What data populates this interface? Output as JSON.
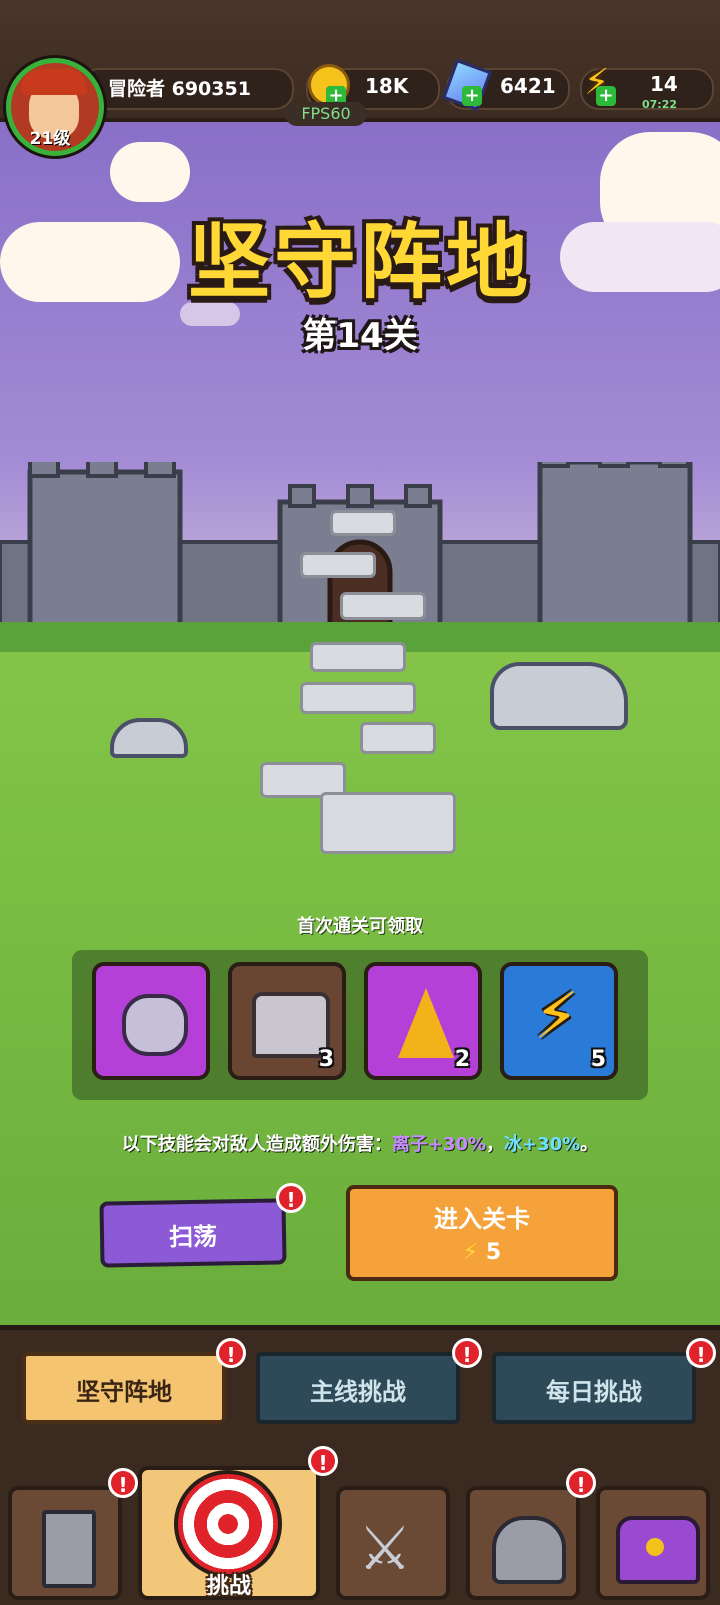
{
  "topbar": {
    "player_name": "冒险者 690351",
    "level": "21级",
    "coins": "18K",
    "gems": "6421",
    "energy": "14",
    "energy_timer": "07:22",
    "fps": "FPS60"
  },
  "stage": {
    "title": "坚守阵地",
    "subtitle": "第14关"
  },
  "rewards": {
    "label": "首次通关可领取",
    "items": [
      {
        "icon": "rune-stone-icon",
        "count": ""
      },
      {
        "icon": "treasure-chest-icon",
        "count": "3"
      },
      {
        "icon": "crystal-icon",
        "count": "2"
      },
      {
        "icon": "lightning-icon",
        "count": "5"
      }
    ]
  },
  "info": {
    "prefix": "以下技能会对敌人造成额外伤害：",
    "skill1": "离子+30%",
    "sep": "，",
    "skill2": "冰+30%",
    "suffix": "。"
  },
  "actions": {
    "sweep_label": "扫荡",
    "enter_label": "进入关卡",
    "enter_cost": "5",
    "alert": "!"
  },
  "mode_tabs": [
    "坚守阵地",
    "主线挑战",
    "每日挑战"
  ],
  "bottom_nav": {
    "active_label": "挑战"
  },
  "colors": {
    "title_yellow": "#ffd836",
    "ion_purple": "#c48cff",
    "ice_cyan": "#6fe0ff",
    "sweep_purple": "#8c5ad6",
    "enter_orange": "#f5a23a",
    "alert_red": "#e0232a"
  }
}
